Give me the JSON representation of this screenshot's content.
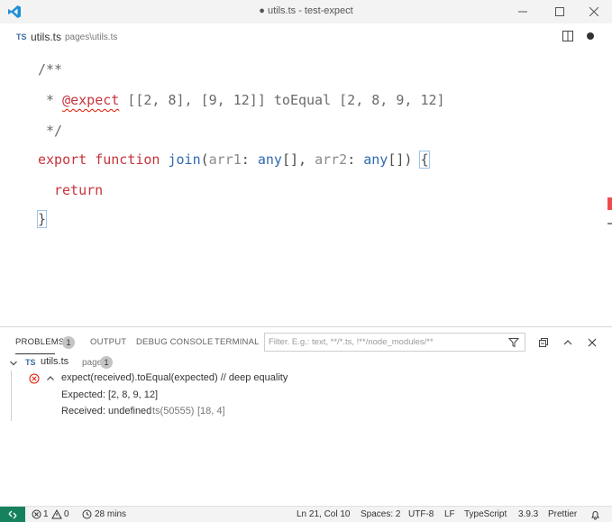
{
  "titlebar": {
    "title": "● utils.ts - test-expect",
    "logo_icon": "vscode-logo-icon"
  },
  "tab": {
    "lang_badge": "TS",
    "file_name": "utils.ts",
    "file_path": "pages\\utils.ts"
  },
  "editor": {
    "lines": {
      "l1": "/**",
      "l2_prefix": " * ",
      "l2_tag": "@expect",
      "l2_rest": " [[2, 8], [9, 12]] toEqual [2, 8, 9, 12]",
      "l3": " */",
      "l4_export": "export",
      "l4_function": "function",
      "l4_name": "join",
      "l4_p1": "arr1",
      "l4_t1": "any",
      "l4_p2": "arr2",
      "l4_t2": "any",
      "l5_return": "return",
      "l6": "}"
    }
  },
  "panel": {
    "tabs": {
      "problems": "PROBLEMS",
      "problems_count": "1",
      "output": "OUTPUT",
      "debug_console": "DEBUG CONSOLE",
      "terminal": "TERMINAL"
    },
    "filter_placeholder": "Filter. E.g.: text, **/*.ts, !**/node_modules/**",
    "file_group": {
      "badge": "TS",
      "file": "utils.ts",
      "folder": "pages",
      "count": "1"
    },
    "problem": {
      "message": "expect(received).toEqual(expected) // deep equality",
      "expected": "Expected: [2, 8, 9, 12]",
      "received": "Received: undefined",
      "source": "ts(50555)",
      "position": "[18, 4]"
    }
  },
  "statusbar": {
    "errors": "1",
    "warnings": "0",
    "time": "28 mins",
    "cursor": "Ln 21, Col 10",
    "spaces": "Spaces: 2",
    "encoding": "UTF-8",
    "eol": "LF",
    "language": "TypeScript",
    "version": "3.9.3",
    "formatter": "Prettier"
  },
  "colors": {
    "accent_blue": "#0078d4",
    "error_red": "#e51400",
    "keyword_red": "#c7343c",
    "function_blue": "#2f6ab0",
    "remote_green": "#16825d"
  }
}
